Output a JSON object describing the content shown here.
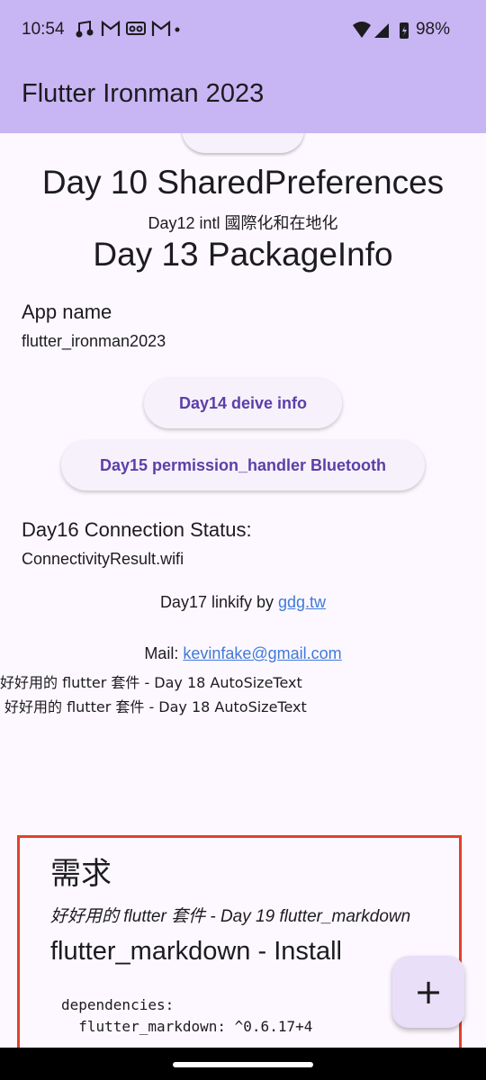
{
  "status_bar": {
    "time": "10:54",
    "left_icons": [
      "music-note-icon",
      "gmail-icon",
      "voicemail-icon",
      "gmail-icon",
      "dot-icon"
    ],
    "battery": "98%"
  },
  "app_bar": {
    "title": "Flutter Ironman 2023"
  },
  "main": {
    "day10_title": "Day 10 SharedPreferences",
    "day12_text": "Day12 intl 國際化和在地化",
    "day13_title": "Day 13 PackageInfo",
    "app_name_label": "App name",
    "app_name_value": "flutter_ironman2023",
    "day14_button": "Day14 deive info",
    "day15_button": "Day15 permission_handler Bluetooth",
    "day16_label": "Day16 Connection Status:",
    "day16_value": "ConnectivityResult.wifi",
    "day17_prefix": "Day17 linkify by ",
    "day17_link": "gdg.tw",
    "mail_prefix": "Mail: ",
    "mail_link": "kevinfake@gmail.com",
    "autosize_line_1": "好好用的 flutter 套件 - Day 18 AutoSizeText",
    "autosize_line_2": "好好用的 flutter 套件 - Day 18 AutoSizeText"
  },
  "markdown": {
    "heading": "需求",
    "italic": "好好用的 flutter 套件 - Day 19 flutter_markdown",
    "h2": "flutter_markdown - Install",
    "code": "dependencies:\n  flutter_markdown: ^0.6.17+4"
  },
  "fab": {
    "icon": "plus-icon",
    "label": "+"
  },
  "colors": {
    "app_bar": "#c8b5f4",
    "button_text": "#5b3fa8",
    "link": "#3f7ad8",
    "highlight_border": "#e2412f"
  }
}
